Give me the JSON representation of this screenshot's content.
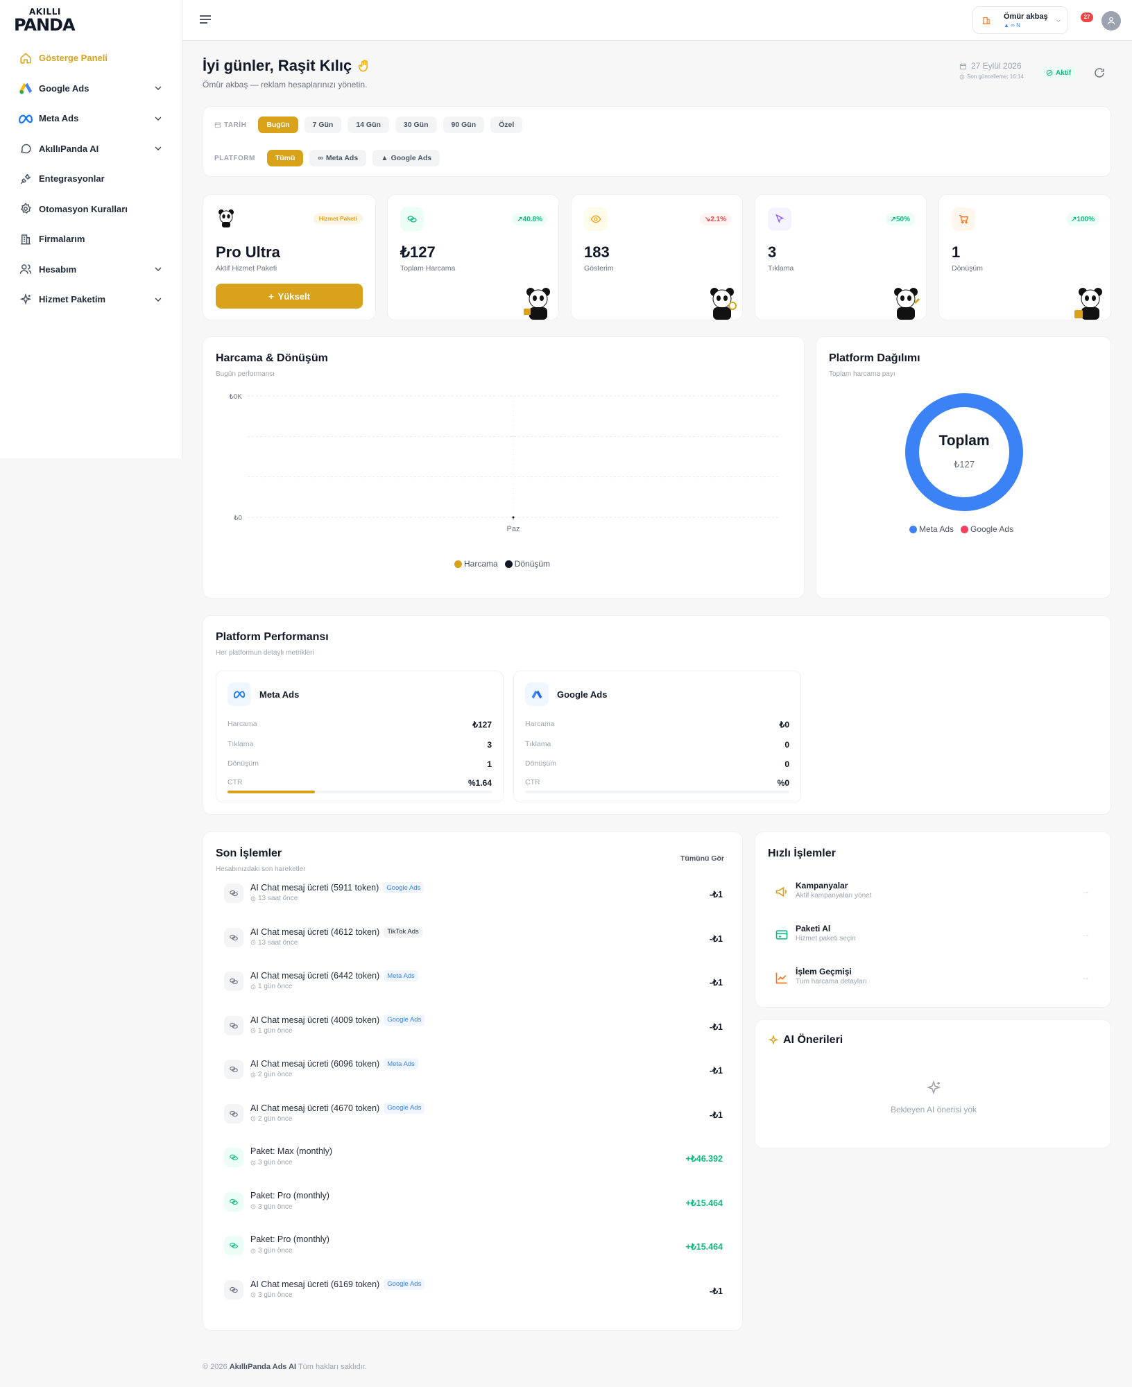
{
  "brand": {
    "line1": "AKILLI",
    "line2": "PANDA"
  },
  "sidebar": {
    "items": [
      {
        "label": "Gösterge Paneli",
        "icon": "home-icon",
        "active": true,
        "expandable": false
      },
      {
        "label": "Google Ads",
        "icon": "google-ads-icon",
        "active": false,
        "expandable": true
      },
      {
        "label": "Meta Ads",
        "icon": "meta-icon",
        "active": false,
        "expandable": true
      },
      {
        "label": "AkıllıPanda AI",
        "icon": "chat-icon",
        "active": false,
        "expandable": true
      },
      {
        "label": "Entegrasyonlar",
        "icon": "plug-icon",
        "active": false,
        "expandable": false
      },
      {
        "label": "Otomasyon Kuralları",
        "icon": "gear-icon",
        "active": false,
        "expandable": false
      },
      {
        "label": "Firmalarım",
        "icon": "building-icon",
        "active": false,
        "expandable": false
      },
      {
        "label": "Hesabım",
        "icon": "users-icon",
        "active": false,
        "expandable": true
      },
      {
        "label": "Hizmet Paketim",
        "icon": "sparkle-icon",
        "active": false,
        "expandable": true
      }
    ]
  },
  "topbar": {
    "user_name": "Ömür akbaş",
    "user_platforms": "N",
    "notification_count": "27"
  },
  "header": {
    "greeting": "İyi günler, Raşit Kılıç",
    "subtitle": "Ömür akbaş — reklam hesaplarınızı yönetin.",
    "date": "27 Eylül 2026",
    "last_update": "Son güncelleme: 16:14",
    "status": "Aktif"
  },
  "filters": {
    "date_label": "TARİH",
    "date_options": [
      "Bugün",
      "7 Gün",
      "14 Gün",
      "30 Gün",
      "90 Gün",
      "Özel"
    ],
    "date_selected": "Bugün",
    "platform_label": "PLATFORM",
    "platform_options": [
      "Tümü",
      "Meta Ads",
      "Google Ads"
    ],
    "platform_selected": "Tümü"
  },
  "package_card": {
    "tag": "Hizmet Paketi",
    "name": "Pro Ultra",
    "label": "Aktif Hizmet Paketi",
    "button": "Yükselt"
  },
  "stats": [
    {
      "value": "₺127",
      "label": "Toplam Harcama",
      "trend": "40.8%",
      "direction": "up",
      "icon": "money-icon",
      "color": "#10b981"
    },
    {
      "value": "183",
      "label": "Gösterim",
      "trend": "2.1%",
      "direction": "down",
      "icon": "eye-icon",
      "color": "#f59e0b"
    },
    {
      "value": "3",
      "label": "Tıklama",
      "trend": "50%",
      "direction": "up",
      "icon": "cursor-icon",
      "color": "#8b5cf6"
    },
    {
      "value": "1",
      "label": "Dönüşüm",
      "trend": "100%",
      "direction": "up",
      "icon": "cart-icon",
      "color": "#f97316"
    }
  ],
  "spend_chart": {
    "title": "Harcama & Dönüşüm",
    "subtitle": "Bugün performansı",
    "legend": [
      "Harcama",
      "Dönüşüm"
    ]
  },
  "platform_dist": {
    "title": "Platform Dağılımı",
    "subtitle": "Toplam harcama payı",
    "center_label": "Toplam",
    "center_value": "₺127",
    "legend": [
      "Meta Ads",
      "Google Ads"
    ]
  },
  "chart_data": [
    {
      "type": "line",
      "title": "Harcama & Dönüşüm",
      "categories": [
        "Paz"
      ],
      "series": [
        {
          "name": "Harcama",
          "values": [
            0
          ],
          "color": "#d9a21b"
        },
        {
          "name": "Dönüşüm",
          "values": [
            0
          ],
          "color": "#111827"
        }
      ],
      "y_tick_labels": [
        "₺0",
        "₺0K"
      ],
      "grid": true,
      "legend_position": "bottom"
    },
    {
      "type": "pie",
      "title": "Platform Dağılımı",
      "categories": [
        "Meta Ads",
        "Google Ads"
      ],
      "values": [
        127,
        0
      ],
      "colors": [
        "#3b82f6",
        "#f43f5e"
      ],
      "legend_position": "bottom"
    }
  ],
  "platform_perf": {
    "title": "Platform Performansı",
    "subtitle": "Her platformun detaylı metrikleri",
    "platforms": [
      {
        "name": "Meta Ads",
        "icon": "meta-icon",
        "rows": [
          [
            "Harcama",
            "₺127"
          ],
          [
            "Tıklama",
            "3"
          ],
          [
            "Dönüşüm",
            "1"
          ],
          [
            "CTR",
            "%1.64"
          ]
        ],
        "ctr_fraction": 0.33
      },
      {
        "name": "Google Ads",
        "icon": "google-ads-icon",
        "rows": [
          [
            "Harcama",
            "₺0"
          ],
          [
            "Tıklama",
            "0"
          ],
          [
            "Dönüşüm",
            "0"
          ],
          [
            "CTR",
            "%0"
          ]
        ],
        "ctr_fraction": 0
      }
    ]
  },
  "transactions": {
    "title": "Son İşlemler",
    "subtitle": "Hesabınızdaki son hareketler",
    "see_all": "Tümünü Gör",
    "items": [
      {
        "title": "AI Chat mesaj ücreti (5911 token)",
        "tag": "Google Ads",
        "tag_style": "blue",
        "time": "13 saat önce",
        "amount": "-₺1",
        "positive": false
      },
      {
        "title": "AI Chat mesaj ücreti (4612 token)",
        "tag": "TikTok Ads",
        "tag_style": "gray",
        "time": "13 saat önce",
        "amount": "-₺1",
        "positive": false
      },
      {
        "title": "AI Chat mesaj ücreti (6442 token)",
        "tag": "Meta Ads",
        "tag_style": "blue",
        "time": "1 gün önce",
        "amount": "-₺1",
        "positive": false
      },
      {
        "title": "AI Chat mesaj ücreti (4009 token)",
        "tag": "Google Ads",
        "tag_style": "blue",
        "time": "1 gün önce",
        "amount": "-₺1",
        "positive": false
      },
      {
        "title": "AI Chat mesaj ücreti (6096 token)",
        "tag": "Meta Ads",
        "tag_style": "blue",
        "time": "2 gün önce",
        "amount": "-₺1",
        "positive": false
      },
      {
        "title": "AI Chat mesaj ücreti (4670 token)",
        "tag": "Google Ads",
        "tag_style": "blue",
        "time": "2 gün önce",
        "amount": "-₺1",
        "positive": false
      },
      {
        "title": "Paket: Max (monthly)",
        "tag": "",
        "tag_style": "",
        "time": "3 gün önce",
        "amount": "+₺46.392",
        "positive": true
      },
      {
        "title": "Paket: Pro (monthly)",
        "tag": "",
        "tag_style": "",
        "time": "3 gün önce",
        "amount": "+₺15.464",
        "positive": true
      },
      {
        "title": "Paket: Pro (monthly)",
        "tag": "",
        "tag_style": "",
        "time": "3 gün önce",
        "amount": "+₺15.464",
        "positive": true
      },
      {
        "title": "AI Chat mesaj ücreti (6169 token)",
        "tag": "Google Ads",
        "tag_style": "blue",
        "time": "3 gün önce",
        "amount": "-₺1",
        "positive": false
      }
    ]
  },
  "quick_actions": {
    "title": "Hızlı İşlemler",
    "items": [
      {
        "title": "Kampanyalar",
        "sub": "Aktif kampanyaları yönet",
        "icon": "megaphone-icon",
        "color": "#d9a21b"
      },
      {
        "title": "Paketi Al",
        "sub": "Hizmet paketi seçin",
        "icon": "card-icon",
        "color": "#10b981"
      },
      {
        "title": "İşlem Geçmişi",
        "sub": "Tüm harcama detayları",
        "icon": "trend-icon",
        "color": "#f97316"
      }
    ]
  },
  "ai_suggestions": {
    "title": "AI Önerileri",
    "empty": "Bekleyen AI önerisi yok"
  },
  "footer": {
    "prefix": "© 2026",
    "brand": "AkıllıPanda Ads AI",
    "suffix": "Tüm hakları saklıdır."
  },
  "colors": {
    "accent": "#d9a21b",
    "meta_blue": "#3b82f6",
    "google_red": "#f43f5e",
    "success": "#10b981",
    "danger": "#ef4444"
  }
}
